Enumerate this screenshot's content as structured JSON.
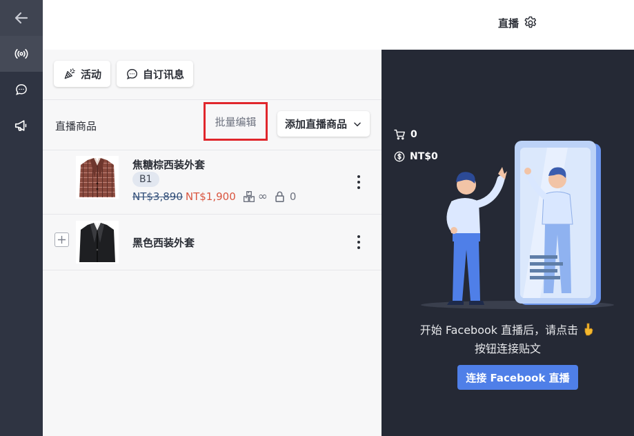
{
  "header": {
    "title": "直播"
  },
  "toolbar": {
    "activity_label": "活动",
    "custom_message_label": "自订讯息"
  },
  "products_section": {
    "title": "直播商品",
    "bulk_edit_label": "批量编辑",
    "add_label": "添加直播商品"
  },
  "products": [
    {
      "name": "焦糖棕西装外套",
      "badge": "B1",
      "original_price": "NT$3,890",
      "sale_price": "NT$1,900",
      "stock": "∞",
      "locked": "0"
    },
    {
      "name": "黑色西装外套"
    }
  ],
  "live_panel": {
    "cart_count": "0",
    "total_amount": "NT$0",
    "hint_line1": "开始 Facebook 直播后，请点击",
    "hint_line2": "按钮连接贴文",
    "connect_label": "连接 Facebook 直播"
  },
  "colors": {
    "sidebar_bg": "#2f3442",
    "panel_bg": "#252935",
    "accent": "#4f7fe8",
    "sale_price": "#d9553f",
    "highlight_border": "#e0262c"
  }
}
